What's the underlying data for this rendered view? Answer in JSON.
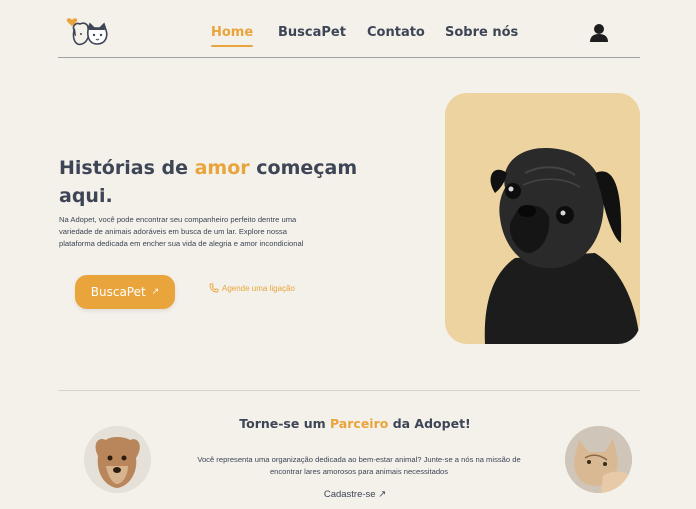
{
  "nav": {
    "items": [
      {
        "label": "Home",
        "active": true
      },
      {
        "label": "BuscaPet",
        "active": false
      },
      {
        "label": "Contato",
        "active": false
      },
      {
        "label": "Sobre nós",
        "active": false
      }
    ],
    "logo_icon": "cat-dog-heart-logo",
    "user_icon": "user-icon"
  },
  "hero": {
    "title_part1": "Histórias de ",
    "title_accent": "amor",
    "title_part2": " começam aqui.",
    "description": "Na Adopet, você pode encontrar seu companheiro perfeito dentre uma variedade de animais adoráveis em busca de um lar. Explore nossa plataforma dedicada em encher sua vida de alegria e amor incondicional",
    "cta_label": "BuscaPet",
    "cta_arrow": "↗",
    "call_label": "Agende uma ligação",
    "image_icon": "pug-photo"
  },
  "partner": {
    "title_part1": "Torne-se um ",
    "title_accent": "Parceiro",
    "title_part2": " da Adopet!",
    "text": "Você representa uma organização dedicada ao bem-estar animal? Junte-se a nós na missão de encontrar lares amorosos para animais necessitados",
    "signup_label": "Cadastre-se ↗"
  },
  "colors": {
    "background": "#f3f1ea",
    "accent": "#e9a43c",
    "text": "#3e4555",
    "image_bg": "#edd3a0"
  }
}
